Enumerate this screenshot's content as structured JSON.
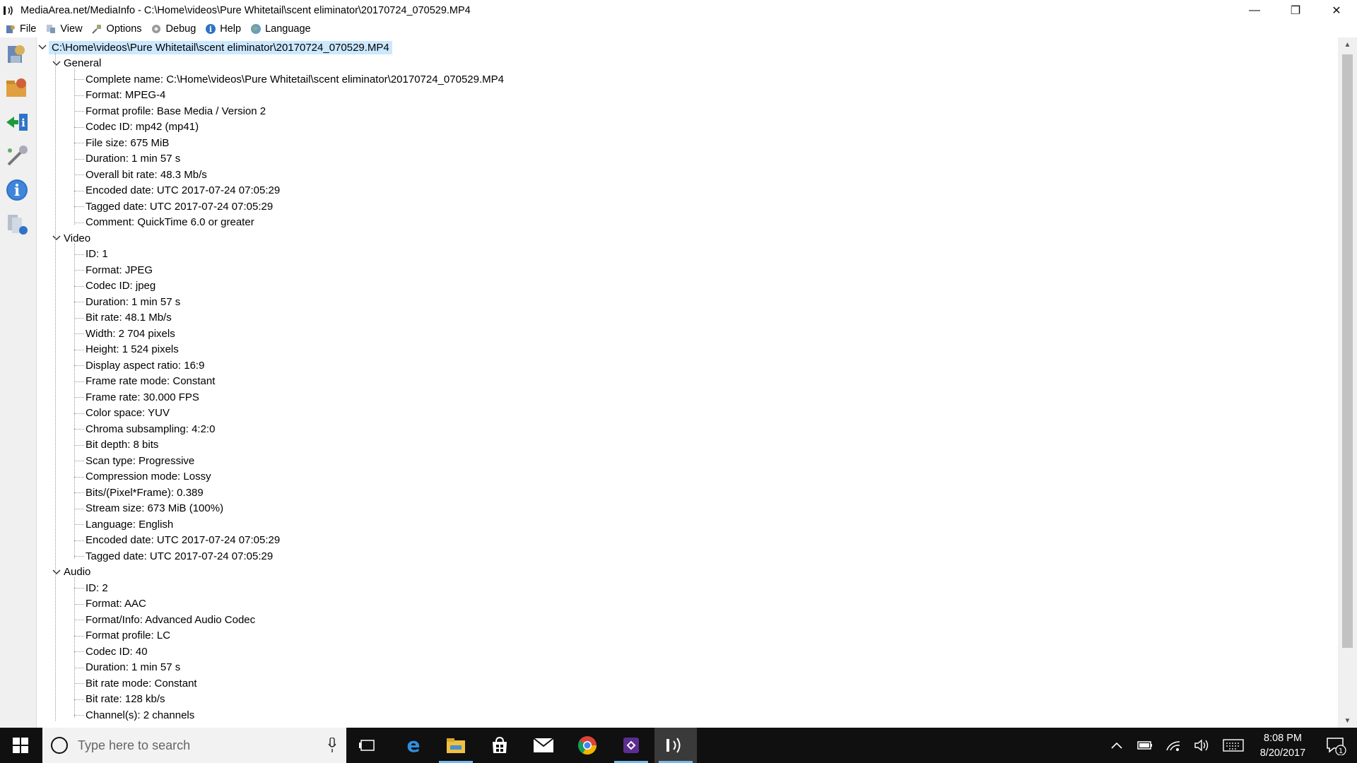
{
  "window": {
    "title": "MediaArea.net/MediaInfo - C:\\Home\\videos\\Pure Whitetail\\scent eliminator\\20170724_070529.MP4",
    "minimize": "—",
    "restore": "❐",
    "close": "✕"
  },
  "menu": [
    {
      "label": "File",
      "icon": "file-icon"
    },
    {
      "label": "View",
      "icon": "view-icon"
    },
    {
      "label": "Options",
      "icon": "options-icon"
    },
    {
      "label": "Debug",
      "icon": "debug-icon"
    },
    {
      "label": "Help",
      "icon": "help-icon"
    },
    {
      "label": "Language",
      "icon": "language-icon"
    }
  ],
  "tree": {
    "root": "C:\\Home\\videos\\Pure Whitetail\\scent eliminator\\20170724_070529.MP4",
    "sections": [
      {
        "name": "General",
        "items": [
          "Complete name: C:\\Home\\videos\\Pure Whitetail\\scent eliminator\\20170724_070529.MP4",
          "Format: MPEG-4",
          "Format profile: Base Media / Version 2",
          "Codec ID: mp42 (mp41)",
          "File size: 675 MiB",
          "Duration: 1 min 57 s",
          "Overall bit rate: 48.3 Mb/s",
          "Encoded date: UTC 2017-07-24 07:05:29",
          "Tagged date: UTC 2017-07-24 07:05:29",
          "Comment: QuickTime 6.0 or greater"
        ]
      },
      {
        "name": "Video",
        "items": [
          "ID: 1",
          "Format: JPEG",
          "Codec ID: jpeg",
          "Duration: 1 min 57 s",
          "Bit rate: 48.1 Mb/s",
          "Width: 2 704 pixels",
          "Height: 1 524 pixels",
          "Display aspect ratio: 16:9",
          "Frame rate mode: Constant",
          "Frame rate: 30.000 FPS",
          "Color space: YUV",
          "Chroma subsampling: 4:2:0",
          "Bit depth: 8 bits",
          "Scan type: Progressive",
          "Compression mode: Lossy",
          "Bits/(Pixel*Frame): 0.389",
          "Stream size: 673 MiB (100%)",
          "Language: English",
          "Encoded date: UTC 2017-07-24 07:05:29",
          "Tagged date: UTC 2017-07-24 07:05:29"
        ]
      },
      {
        "name": "Audio",
        "items": [
          "ID: 2",
          "Format: AAC",
          "Format/Info: Advanced Audio Codec",
          "Format profile: LC",
          "Codec ID: 40",
          "Duration: 1 min 57 s",
          "Bit rate mode: Constant",
          "Bit rate: 128 kb/s",
          "Channel(s): 2 channels"
        ]
      }
    ]
  },
  "taskbar": {
    "search_placeholder": "Type here to search",
    "time": "8:08 PM",
    "date": "8/20/2017",
    "notification_count": "1",
    "accent_color": "#76b9ed"
  }
}
